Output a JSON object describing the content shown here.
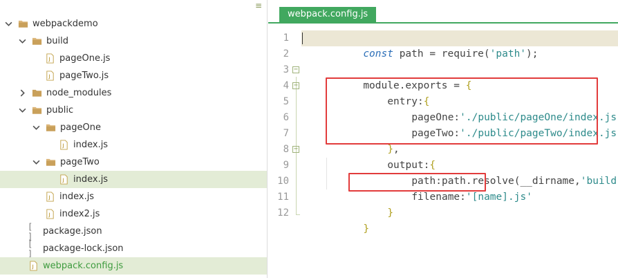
{
  "sidebar": {
    "menu_icon": "menu-icon",
    "items": [
      {
        "label": "webpackdemo",
        "type": "folder",
        "expanded": true
      },
      {
        "label": "build",
        "type": "folder",
        "expanded": true
      },
      {
        "label": "pageOne.js",
        "type": "file"
      },
      {
        "label": "pageTwo.js",
        "type": "file"
      },
      {
        "label": "node_modules",
        "type": "folder",
        "expanded": false
      },
      {
        "label": "public",
        "type": "folder",
        "expanded": true
      },
      {
        "label": "pageOne",
        "type": "folder",
        "expanded": true
      },
      {
        "label": "index.js",
        "type": "file"
      },
      {
        "label": "pageTwo",
        "type": "folder",
        "expanded": true
      },
      {
        "label": "index.js",
        "type": "file",
        "selected": true
      },
      {
        "label": "index.js",
        "type": "file"
      },
      {
        "label": "index2.js",
        "type": "file"
      },
      {
        "label": "package.json",
        "type": "json"
      },
      {
        "label": "package-lock.json",
        "type": "json"
      },
      {
        "label": "webpack.config.js",
        "type": "file",
        "selected": true,
        "active": true
      }
    ]
  },
  "editor": {
    "tab_label": "webpack.config.js",
    "lines": [
      {
        "num": "1"
      },
      {
        "num": "2"
      },
      {
        "num": "3"
      },
      {
        "num": "4"
      },
      {
        "num": "5"
      },
      {
        "num": "6"
      },
      {
        "num": "7"
      },
      {
        "num": "8"
      },
      {
        "num": "9"
      },
      {
        "num": "10"
      },
      {
        "num": "11"
      },
      {
        "num": "12"
      }
    ],
    "code": {
      "l1_kw": "const",
      "l1_a": " path = require(",
      "l1_s": "'path'",
      "l1_b": ");",
      "l3_a": "module.exports = ",
      "l3_brace": "{",
      "l4_prop": "entry:",
      "l4_brace": "{",
      "l5_prop": "pageOne:",
      "l5_s": "'./public/pageOne/index.js'",
      "l5_end": ",",
      "l6_prop": "pageTwo:",
      "l6_s": "'./public/pageTwo/index.js'",
      "l7_brace": "}",
      "l7_end": ",",
      "l8_prop": "output:",
      "l8_brace": "{",
      "l9_a": "path:path.resolve(__dirname,",
      "l9_s": "'build'",
      "l9_b": "),",
      "l10_prop": "filename:",
      "l10_s": "'[name].js'",
      "l11_brace": "}",
      "l12_brace": "}"
    },
    "fold_markers": [
      "⊟",
      "⊟",
      "⊟"
    ]
  },
  "colors": {
    "accent": "#41a85f",
    "selection": "#e3ecd6",
    "highlight": "#e23b3b",
    "active_line": "#ece7d5"
  }
}
